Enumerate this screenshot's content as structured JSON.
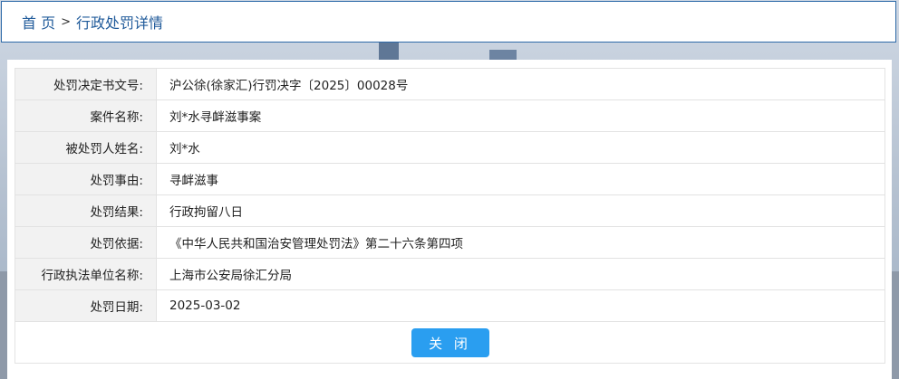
{
  "breadcrumb": {
    "home": "首 页",
    "separator": ">",
    "current": "行政处罚详情"
  },
  "details": [
    {
      "label": "处罚决定书文号:",
      "value": "沪公徐(徐家汇)行罚决字〔2025〕00028号"
    },
    {
      "label": "案件名称:",
      "value": "刘*水寻衅滋事案"
    },
    {
      "label": "被处罚人姓名:",
      "value": "刘*水"
    },
    {
      "label": "处罚事由:",
      "value": "寻衅滋事"
    },
    {
      "label": "处罚结果:",
      "value": "行政拘留八日"
    },
    {
      "label": "处罚依据:",
      "value": "《中华人民共和国治安管理处罚法》第二十六条第四项"
    },
    {
      "label": "行政执法单位名称:",
      "value": "上海市公安局徐汇分局"
    },
    {
      "label": "处罚日期:",
      "value": "2025-03-02"
    }
  ],
  "close_button": "关 闭",
  "colors": {
    "accent": "#2a9ef0",
    "breadcrumb_border": "#2e6aa8",
    "label_bg": "#f2f2f2"
  }
}
